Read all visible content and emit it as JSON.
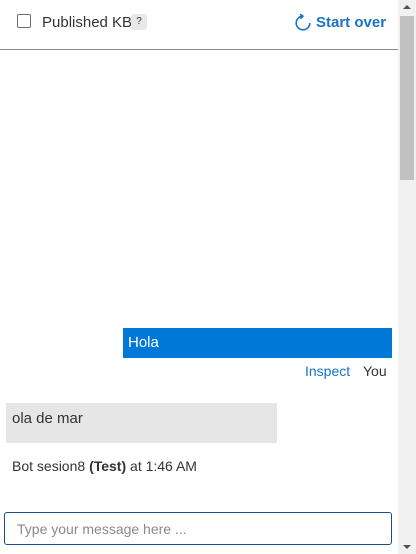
{
  "header": {
    "kb_checkbox_label": "Published KB",
    "help_badge": "?",
    "start_over_label": "Start over"
  },
  "chat": {
    "user_message": "Hola",
    "inspect_label": "Inspect",
    "you_label": "You",
    "bot_message": "ola de mar",
    "bot_meta": {
      "prefix": "Bot sesion8",
      "tag": "(Test)",
      "time": "at 1:46 AM"
    }
  },
  "composer": {
    "placeholder": "Type your message here ..."
  },
  "colors": {
    "accent": "#0078d7",
    "link": "#1a73c6",
    "bot_bubble": "#e6e6e6"
  }
}
